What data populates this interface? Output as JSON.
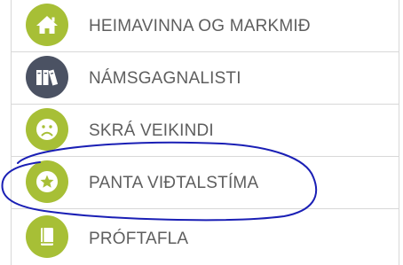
{
  "menu": {
    "items": [
      {
        "label": "HEIMAVINNA OG MARKMIÐ",
        "icon": "home-icon"
      },
      {
        "label": "NÁMSGAGNALISTI",
        "icon": "books-icon"
      },
      {
        "label": "SKRÁ VEIKINDI",
        "icon": "sad-face-icon"
      },
      {
        "label": "PANTA VIÐTALSTÍMA",
        "icon": "star-icon"
      },
      {
        "label": "PRÓFTAFLA",
        "icon": "book-icon"
      }
    ]
  },
  "colors": {
    "accent_green": "#a7bf36",
    "accent_slate": "#4b5263",
    "label_text": "#5e5e5e",
    "annotation_ink": "#1a1fb5"
  }
}
